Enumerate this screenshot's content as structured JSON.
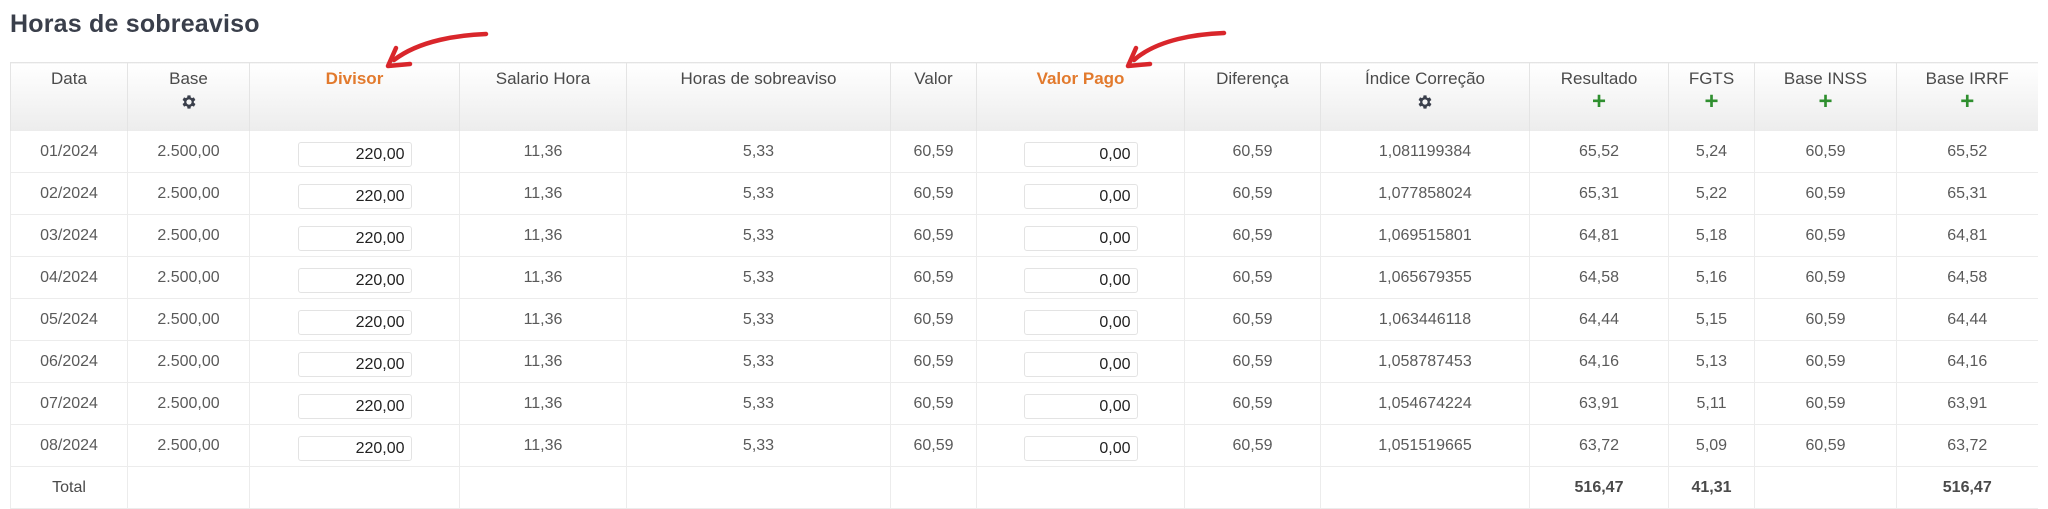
{
  "page": {
    "title": "Horas de sobreaviso"
  },
  "columns": [
    {
      "key": "data",
      "label": "Data",
      "icon": null,
      "highlight": false
    },
    {
      "key": "base",
      "label": "Base",
      "icon": "gear-icon",
      "highlight": false
    },
    {
      "key": "divisor",
      "label": "Divisor",
      "icon": null,
      "highlight": true
    },
    {
      "key": "salario_hora",
      "label": "Salario Hora",
      "icon": null,
      "highlight": false
    },
    {
      "key": "horas",
      "label": "Horas de sobreaviso",
      "icon": null,
      "highlight": false
    },
    {
      "key": "valor",
      "label": "Valor",
      "icon": null,
      "highlight": false
    },
    {
      "key": "valor_pago",
      "label": "Valor Pago",
      "icon": null,
      "highlight": true
    },
    {
      "key": "diferenca",
      "label": "Diferença",
      "icon": null,
      "highlight": false
    },
    {
      "key": "indice",
      "label": "Índice Correção",
      "icon": "gear-icon",
      "highlight": false
    },
    {
      "key": "resultado",
      "label": "Resultado",
      "icon": "plus-icon",
      "highlight": false
    },
    {
      "key": "fgts",
      "label": "FGTS",
      "icon": "plus-icon",
      "highlight": false
    },
    {
      "key": "base_inss",
      "label": "Base INSS",
      "icon": "plus-icon",
      "highlight": false
    },
    {
      "key": "base_irrf",
      "label": "Base IRRF",
      "icon": "plus-icon",
      "highlight": false
    }
  ],
  "plus_symbol": "+",
  "rows": [
    [
      "01/2024",
      "2.500,00",
      "220,00",
      "11,36",
      "5,33",
      "60,59",
      "0,00",
      "60,59",
      "1,081199384",
      "65,52",
      "5,24",
      "60,59",
      "65,52"
    ],
    [
      "02/2024",
      "2.500,00",
      "220,00",
      "11,36",
      "5,33",
      "60,59",
      "0,00",
      "60,59",
      "1,077858024",
      "65,31",
      "5,22",
      "60,59",
      "65,31"
    ],
    [
      "03/2024",
      "2.500,00",
      "220,00",
      "11,36",
      "5,33",
      "60,59",
      "0,00",
      "60,59",
      "1,069515801",
      "64,81",
      "5,18",
      "60,59",
      "64,81"
    ],
    [
      "04/2024",
      "2.500,00",
      "220,00",
      "11,36",
      "5,33",
      "60,59",
      "0,00",
      "60,59",
      "1,065679355",
      "64,58",
      "5,16",
      "60,59",
      "64,58"
    ],
    [
      "05/2024",
      "2.500,00",
      "220,00",
      "11,36",
      "5,33",
      "60,59",
      "0,00",
      "60,59",
      "1,063446118",
      "64,44",
      "5,15",
      "60,59",
      "64,44"
    ],
    [
      "06/2024",
      "2.500,00",
      "220,00",
      "11,36",
      "5,33",
      "60,59",
      "0,00",
      "60,59",
      "1,058787453",
      "64,16",
      "5,13",
      "60,59",
      "64,16"
    ],
    [
      "07/2024",
      "2.500,00",
      "220,00",
      "11,36",
      "5,33",
      "60,59",
      "0,00",
      "60,59",
      "1,054674224",
      "63,91",
      "5,11",
      "60,59",
      "63,91"
    ],
    [
      "08/2024",
      "2.500,00",
      "220,00",
      "11,36",
      "5,33",
      "60,59",
      "0,00",
      "60,59",
      "1,051519665",
      "63,72",
      "5,09",
      "60,59",
      "63,72"
    ]
  ],
  "input_columns": [
    "divisor",
    "valor_pago"
  ],
  "total": {
    "label": "Total",
    "values": [
      "",
      "",
      "",
      "",
      "",
      "",
      "",
      "",
      "516,47",
      "41,31",
      "",
      "516,47"
    ]
  },
  "colors": {
    "highlight": "#e27a2d",
    "plus": "#2f8f2f",
    "annotation_arrow": "#d9262b"
  }
}
